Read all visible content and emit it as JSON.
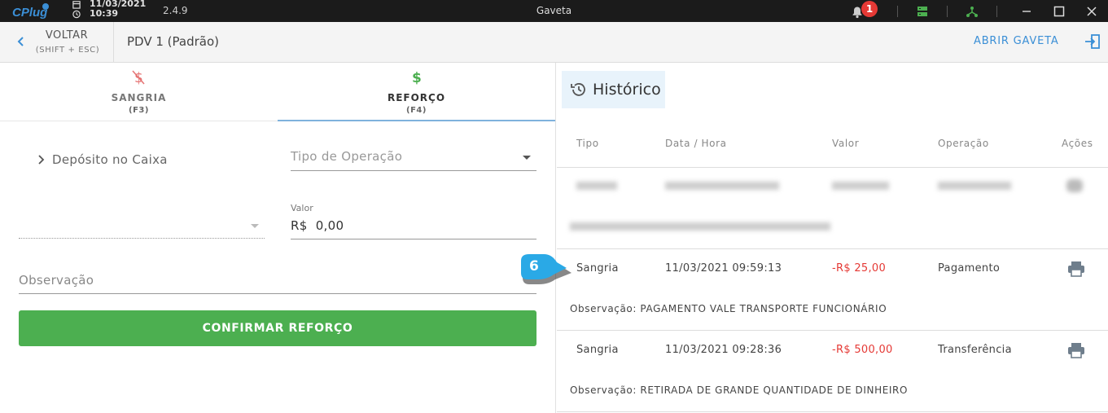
{
  "titlebar": {
    "logo": "CPlug",
    "date": "11/03/2021",
    "time": "10:39",
    "version": "2.4.9",
    "title": "Gaveta",
    "notification_count": "1"
  },
  "header": {
    "back_label": "VOLTAR",
    "back_shortcut": "(SHIFT + ESC)",
    "pdv": "PDV 1 (Padrão)",
    "abrir_gaveta": "ABRIR GAVETA"
  },
  "tabs": [
    {
      "label": "SANGRIA",
      "key": "(F3)",
      "color": "#e57373"
    },
    {
      "label": "REFORÇO",
      "key": "(F4)",
      "color": "#4caf50"
    }
  ],
  "form": {
    "operation_label": "Depósito no Caixa",
    "tipo_placeholder": "Tipo de Operação",
    "valor_label": "Valor",
    "valor_value": "R$  0,00",
    "observacao_placeholder": "Observação",
    "confirm_label": "CONFIRMAR REFORÇO"
  },
  "history": {
    "title": "Histórico",
    "columns": [
      "Tipo",
      "Data / Hora",
      "Valor",
      "Operação",
      "Ações"
    ],
    "obs_prefix": "Observação:",
    "rows": [
      {
        "tipo": "Sangria",
        "data_hora": "11/03/2021 09:59:13",
        "valor": "-R$ 25,00",
        "operacao": "Pagamento",
        "observacao": "Observação: PAGAMENTO VALE TRANSPORTE FUNCIONÁRIO"
      },
      {
        "tipo": "Sangria",
        "data_hora": "11/03/2021 09:28:36",
        "valor": "-R$ 500,00",
        "operacao": "Transferência",
        "observacao": "Observação: RETIRADA DE GRANDE QUANTIDADE DE DINHEIRO"
      }
    ]
  },
  "callout": {
    "number": "6"
  },
  "colors": {
    "accent": "#3b8fd6",
    "confirm": "#4caf50",
    "negative": "#e53935"
  }
}
